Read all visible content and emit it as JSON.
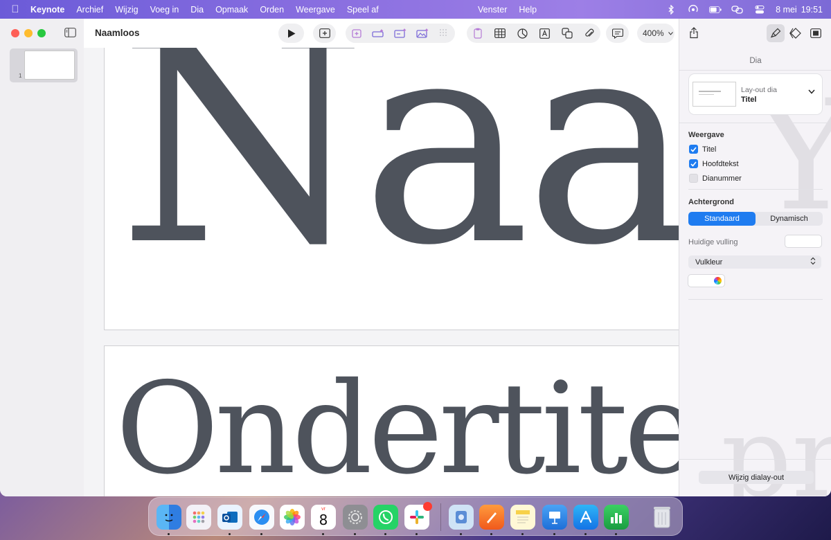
{
  "menubar": {
    "app": "Keynote",
    "items": [
      "Archief",
      "Wijzig",
      "Voeg in",
      "Dia",
      "Opmaak",
      "Orden",
      "Weergave",
      "Speel af"
    ],
    "center_items": [
      "Venster",
      "Help"
    ],
    "date": "8 mei",
    "time": "19:51"
  },
  "window": {
    "title": "Naamloos",
    "zoom": "400%",
    "slide_number": "1"
  },
  "slide": {
    "title_text": "Naam",
    "subtitle_text": "Ondertitel"
  },
  "inspector": {
    "section_title": "Dia",
    "layout": {
      "label": "Lay-out dia",
      "value": "Titel"
    },
    "appearance": {
      "label": "Weergave",
      "options": [
        {
          "label": "Titel",
          "checked": true
        },
        {
          "label": "Hoofdtekst",
          "checked": true
        },
        {
          "label": "Dianummer",
          "checked": false
        }
      ]
    },
    "background": {
      "label": "Achtergrond",
      "segments": [
        "Standaard",
        "Dynamisch"
      ],
      "selected": "Standaard",
      "current_fill_label": "Huidige vulling",
      "fill_type": "Vulkleur"
    },
    "edit_layout_button": "Wijzig dialay-out"
  },
  "dock": {
    "apps": [
      "Finder",
      "Launchpad",
      "Outlook",
      "Safari",
      "Foto's",
      "Agenda",
      "Systeeminstellingen",
      "WhatsApp",
      "Slack",
      "Preview",
      "Pages",
      "Notities",
      "Keynote",
      "App Store",
      "Numbers",
      "Prullenmand"
    ],
    "calendar_day_label": "vr",
    "calendar_day": "8"
  },
  "colors": {
    "accent": "#1f7cf0",
    "slide_text": "#4e535c"
  }
}
